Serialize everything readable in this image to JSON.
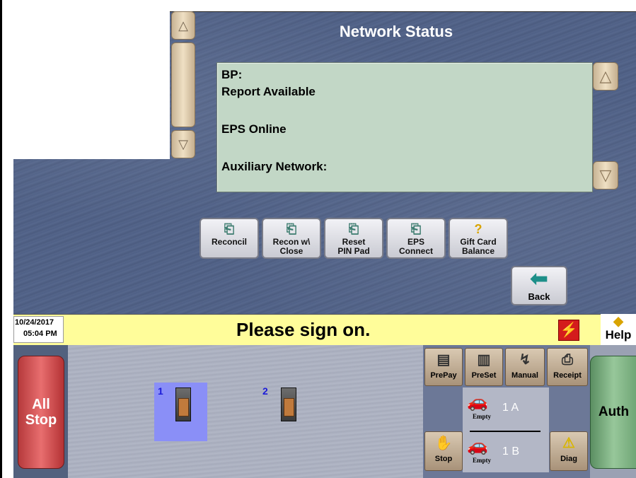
{
  "title": "Network Status",
  "status_lines": [
    "BP:",
    "Report Available",
    "EPS Online",
    "Auxiliary Network:"
  ],
  "function_buttons": [
    {
      "label_line1": "",
      "label_line2": "Reconcil",
      "icon": "register-icon"
    },
    {
      "label_line1": "Recon w\\",
      "label_line2": "Close",
      "icon": "register-icon"
    },
    {
      "label_line1": "Reset",
      "label_line2": "PIN Pad",
      "icon": "register-icon"
    },
    {
      "label_line1": "EPS",
      "label_line2": "Connect",
      "icon": "register-icon"
    },
    {
      "label_line1": "Gift Card",
      "label_line2": "Balance",
      "icon": "question-icon"
    }
  ],
  "back_label": "Back",
  "datetime": {
    "date": "10/24/2017",
    "time": "05:04 PM"
  },
  "prompt": "Please sign on.",
  "help_label": "Help",
  "all_stop": {
    "line1": "All",
    "line2": "Stop"
  },
  "auth_label": "Auth",
  "pumps": [
    {
      "number": "1",
      "selected": true
    },
    {
      "number": "2",
      "selected": false
    }
  ],
  "tool_buttons": [
    "PrePay",
    "PreSet",
    "Manual",
    "Receipt"
  ],
  "stop_label": "Stop",
  "diag_label": "Diag",
  "dispensers": [
    {
      "status": "Empty",
      "id": "1 A"
    },
    {
      "status": "Empty",
      "id": "1 B"
    }
  ],
  "colors": {
    "status_bar": "#fffd9a",
    "status_box": "#c2d7c6",
    "all_stop": "#e86e6f",
    "auth": "#97c79a",
    "selected_pump": "#8a8ff7"
  }
}
